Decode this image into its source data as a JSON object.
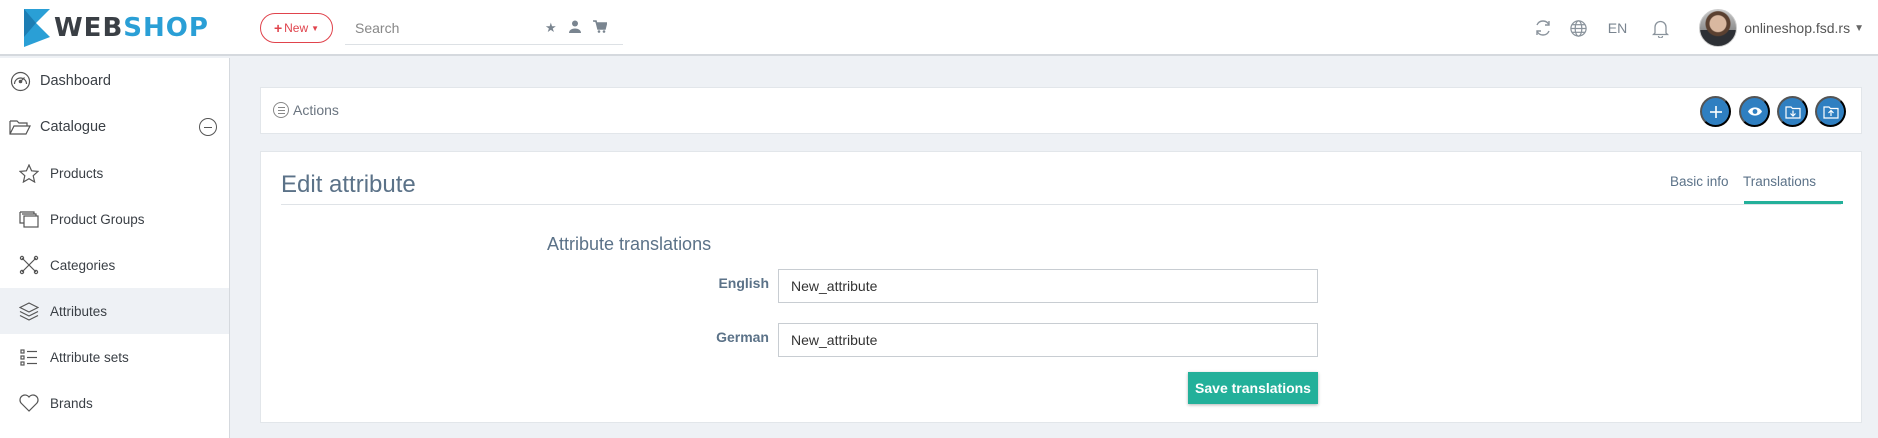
{
  "app": {
    "logo_text_dark": "WEB",
    "logo_text_light": "SHOP",
    "accent": "#2a9fd6"
  },
  "header": {
    "new_label": "New",
    "search_placeholder": "Search",
    "search_icons": [
      "star-icon",
      "user-icon",
      "cart-icon"
    ],
    "language": "EN",
    "user_name": "onlineshop.fsd.rs"
  },
  "sidebar": {
    "items": [
      {
        "label": "Dashboard",
        "icon": "dashboard-icon"
      },
      {
        "label": "Catalogue",
        "icon": "folder-icon"
      },
      {
        "label": "Products",
        "icon": "star-icon"
      },
      {
        "label": "Product Groups",
        "icon": "stack-icon"
      },
      {
        "label": "Categories",
        "icon": "nodes-icon"
      },
      {
        "label": "Attributes",
        "icon": "layers-icon",
        "active": true
      },
      {
        "label": "Attribute sets",
        "icon": "list-icon"
      },
      {
        "label": "Brands",
        "icon": "heart-icon"
      }
    ]
  },
  "actions": {
    "label": "Actions",
    "buttons": [
      "add-icon",
      "view-icon",
      "import-icon",
      "export-icon"
    ]
  },
  "card": {
    "title": "Edit attribute",
    "tabs": [
      {
        "label": "Basic info",
        "active": false
      },
      {
        "label": "Translations",
        "active": true
      }
    ],
    "section_title": "Attribute translations",
    "fields": [
      {
        "label": "English",
        "value": "New_attribute"
      },
      {
        "label": "German",
        "value": "New_attribute"
      }
    ],
    "save_label": "Save translations"
  },
  "colors": {
    "primary_button": "#2f7fc1",
    "success": "#23b09a",
    "danger": "#e0434c"
  }
}
